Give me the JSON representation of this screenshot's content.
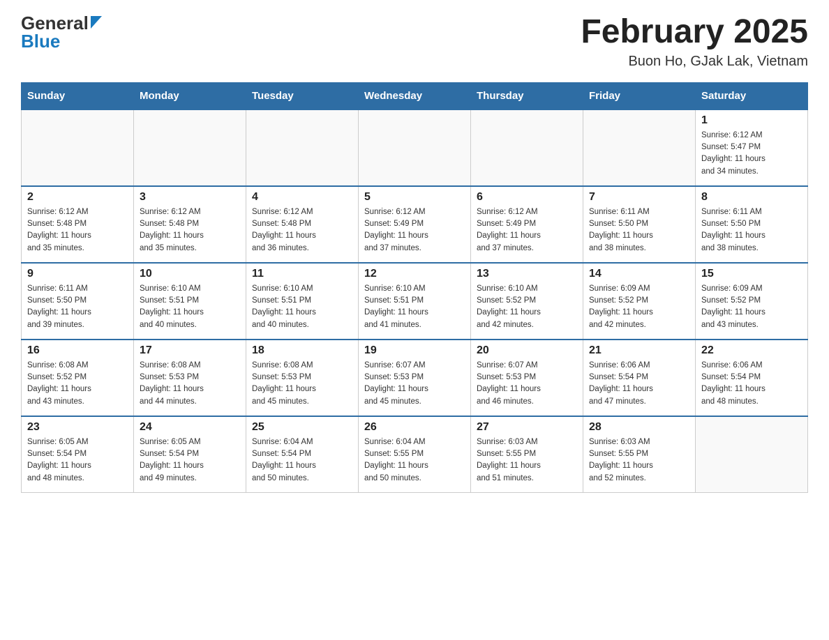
{
  "header": {
    "logo_general": "General",
    "logo_blue": "Blue",
    "title": "February 2025",
    "location": "Buon Ho, GJak Lak, Vietnam"
  },
  "days_of_week": [
    "Sunday",
    "Monday",
    "Tuesday",
    "Wednesday",
    "Thursday",
    "Friday",
    "Saturday"
  ],
  "weeks": [
    [
      {
        "day": "",
        "info": ""
      },
      {
        "day": "",
        "info": ""
      },
      {
        "day": "",
        "info": ""
      },
      {
        "day": "",
        "info": ""
      },
      {
        "day": "",
        "info": ""
      },
      {
        "day": "",
        "info": ""
      },
      {
        "day": "1",
        "info": "Sunrise: 6:12 AM\nSunset: 5:47 PM\nDaylight: 11 hours\nand 34 minutes."
      }
    ],
    [
      {
        "day": "2",
        "info": "Sunrise: 6:12 AM\nSunset: 5:48 PM\nDaylight: 11 hours\nand 35 minutes."
      },
      {
        "day": "3",
        "info": "Sunrise: 6:12 AM\nSunset: 5:48 PM\nDaylight: 11 hours\nand 35 minutes."
      },
      {
        "day": "4",
        "info": "Sunrise: 6:12 AM\nSunset: 5:48 PM\nDaylight: 11 hours\nand 36 minutes."
      },
      {
        "day": "5",
        "info": "Sunrise: 6:12 AM\nSunset: 5:49 PM\nDaylight: 11 hours\nand 37 minutes."
      },
      {
        "day": "6",
        "info": "Sunrise: 6:12 AM\nSunset: 5:49 PM\nDaylight: 11 hours\nand 37 minutes."
      },
      {
        "day": "7",
        "info": "Sunrise: 6:11 AM\nSunset: 5:50 PM\nDaylight: 11 hours\nand 38 minutes."
      },
      {
        "day": "8",
        "info": "Sunrise: 6:11 AM\nSunset: 5:50 PM\nDaylight: 11 hours\nand 38 minutes."
      }
    ],
    [
      {
        "day": "9",
        "info": "Sunrise: 6:11 AM\nSunset: 5:50 PM\nDaylight: 11 hours\nand 39 minutes."
      },
      {
        "day": "10",
        "info": "Sunrise: 6:10 AM\nSunset: 5:51 PM\nDaylight: 11 hours\nand 40 minutes."
      },
      {
        "day": "11",
        "info": "Sunrise: 6:10 AM\nSunset: 5:51 PM\nDaylight: 11 hours\nand 40 minutes."
      },
      {
        "day": "12",
        "info": "Sunrise: 6:10 AM\nSunset: 5:51 PM\nDaylight: 11 hours\nand 41 minutes."
      },
      {
        "day": "13",
        "info": "Sunrise: 6:10 AM\nSunset: 5:52 PM\nDaylight: 11 hours\nand 42 minutes."
      },
      {
        "day": "14",
        "info": "Sunrise: 6:09 AM\nSunset: 5:52 PM\nDaylight: 11 hours\nand 42 minutes."
      },
      {
        "day": "15",
        "info": "Sunrise: 6:09 AM\nSunset: 5:52 PM\nDaylight: 11 hours\nand 43 minutes."
      }
    ],
    [
      {
        "day": "16",
        "info": "Sunrise: 6:08 AM\nSunset: 5:52 PM\nDaylight: 11 hours\nand 43 minutes."
      },
      {
        "day": "17",
        "info": "Sunrise: 6:08 AM\nSunset: 5:53 PM\nDaylight: 11 hours\nand 44 minutes."
      },
      {
        "day": "18",
        "info": "Sunrise: 6:08 AM\nSunset: 5:53 PM\nDaylight: 11 hours\nand 45 minutes."
      },
      {
        "day": "19",
        "info": "Sunrise: 6:07 AM\nSunset: 5:53 PM\nDaylight: 11 hours\nand 45 minutes."
      },
      {
        "day": "20",
        "info": "Sunrise: 6:07 AM\nSunset: 5:53 PM\nDaylight: 11 hours\nand 46 minutes."
      },
      {
        "day": "21",
        "info": "Sunrise: 6:06 AM\nSunset: 5:54 PM\nDaylight: 11 hours\nand 47 minutes."
      },
      {
        "day": "22",
        "info": "Sunrise: 6:06 AM\nSunset: 5:54 PM\nDaylight: 11 hours\nand 48 minutes."
      }
    ],
    [
      {
        "day": "23",
        "info": "Sunrise: 6:05 AM\nSunset: 5:54 PM\nDaylight: 11 hours\nand 48 minutes."
      },
      {
        "day": "24",
        "info": "Sunrise: 6:05 AM\nSunset: 5:54 PM\nDaylight: 11 hours\nand 49 minutes."
      },
      {
        "day": "25",
        "info": "Sunrise: 6:04 AM\nSunset: 5:54 PM\nDaylight: 11 hours\nand 50 minutes."
      },
      {
        "day": "26",
        "info": "Sunrise: 6:04 AM\nSunset: 5:55 PM\nDaylight: 11 hours\nand 50 minutes."
      },
      {
        "day": "27",
        "info": "Sunrise: 6:03 AM\nSunset: 5:55 PM\nDaylight: 11 hours\nand 51 minutes."
      },
      {
        "day": "28",
        "info": "Sunrise: 6:03 AM\nSunset: 5:55 PM\nDaylight: 11 hours\nand 52 minutes."
      },
      {
        "day": "",
        "info": ""
      }
    ]
  ]
}
